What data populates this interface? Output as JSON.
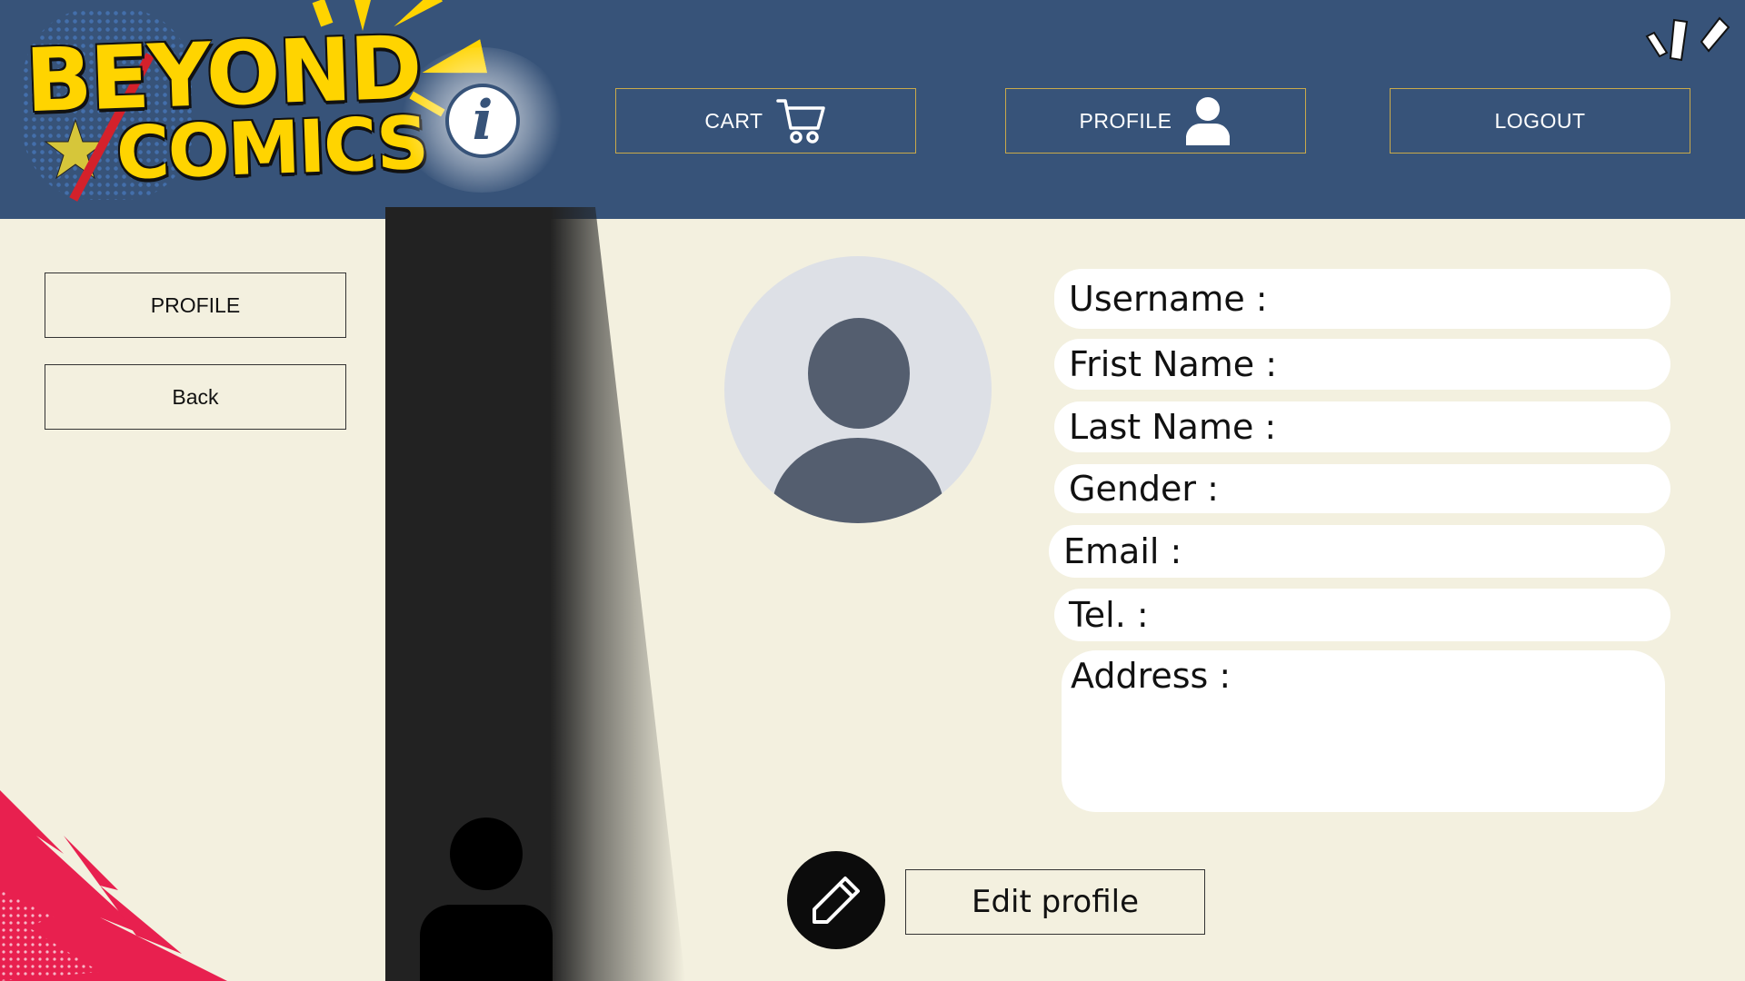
{
  "header": {
    "logo": {
      "line1": "BEYOND",
      "line2": "COMICS"
    },
    "info_glyph": "i",
    "nav": [
      {
        "label": "CART",
        "icon": "cart-icon"
      },
      {
        "label": "PROFILE",
        "icon": "user-icon"
      },
      {
        "label": "LOGOUT"
      }
    ]
  },
  "sidebar": {
    "items": [
      {
        "label": "PROFILE"
      },
      {
        "label": "Back"
      }
    ]
  },
  "profile": {
    "avatar_icon": "default-avatar-icon",
    "fields": {
      "username": "Username :",
      "first_name": "Frist Name :",
      "last_name": "Last Name :",
      "gender": "Gender :",
      "email": "Email :",
      "tel": "Tel. :",
      "address": "Address :"
    },
    "edit_icon": "pencil-icon",
    "edit_label": "Edit profile"
  },
  "colors": {
    "header_bg": "#375379",
    "page_bg": "#f3f0df",
    "logo_yellow": "#ffd400",
    "nav_border": "#c9a94a",
    "accent_red": "#e8204f"
  }
}
